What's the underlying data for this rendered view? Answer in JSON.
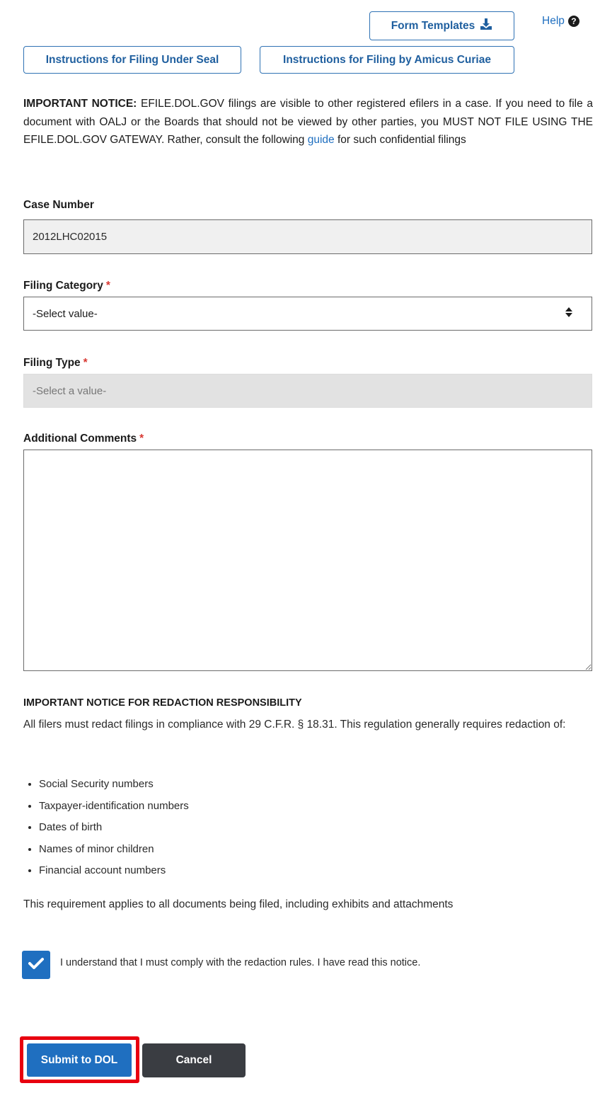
{
  "toolbar": {
    "form_templates_label": "Form Templates",
    "help_label": "Help",
    "under_seal_label": "Instructions for Filing Under Seal",
    "amicus_label": "Instructions for Filing by Amicus Curiae"
  },
  "notice": {
    "heading": "IMPORTANT NOTICE:",
    "body_before_link": "EFILE.DOL.GOV filings are visible to other registered efilers in a case. If you need to file a document with OALJ or the Boards that should not be viewed by other parties, you MUST NOT FILE USING THE EFILE.DOL.GOV GATEWAY. Rather, consult the following",
    "link_text": "guide",
    "body_after_link": "for such confidential filings"
  },
  "form": {
    "case_number_label": "Case Number",
    "case_number_value": "2012LHC02015",
    "filing_category_label": "Filing Category",
    "filing_category_value": "-Select value-",
    "filing_type_label": "Filing Type",
    "filing_type_value": "-Select a value-",
    "comments_label": "Additional Comments",
    "required_mark": "*"
  },
  "redaction": {
    "title": "IMPORTANT NOTICE FOR REDACTION RESPONSIBILITY",
    "intro": "All filers must redact filings in compliance with 29 C.F.R. § 18.31. This regulation generally requires redaction of:",
    "items": [
      "Social Security numbers",
      "Taxpayer-identification numbers",
      "Dates of birth",
      "Names of minor children",
      "Financial account numbers"
    ],
    "footer": "This requirement applies to all documents being filed, including exhibits and attachments",
    "checkbox_label": "I understand that I must comply with the redaction rules. I have read this notice.",
    "checkbox_checked": true
  },
  "actions": {
    "submit_label": "Submit to DOL",
    "cancel_label": "Cancel"
  },
  "colors": {
    "accent": "#1f6fc0",
    "required": "#d83933",
    "highlight": "#e8000f",
    "cancel_bg": "#3a3d42"
  }
}
